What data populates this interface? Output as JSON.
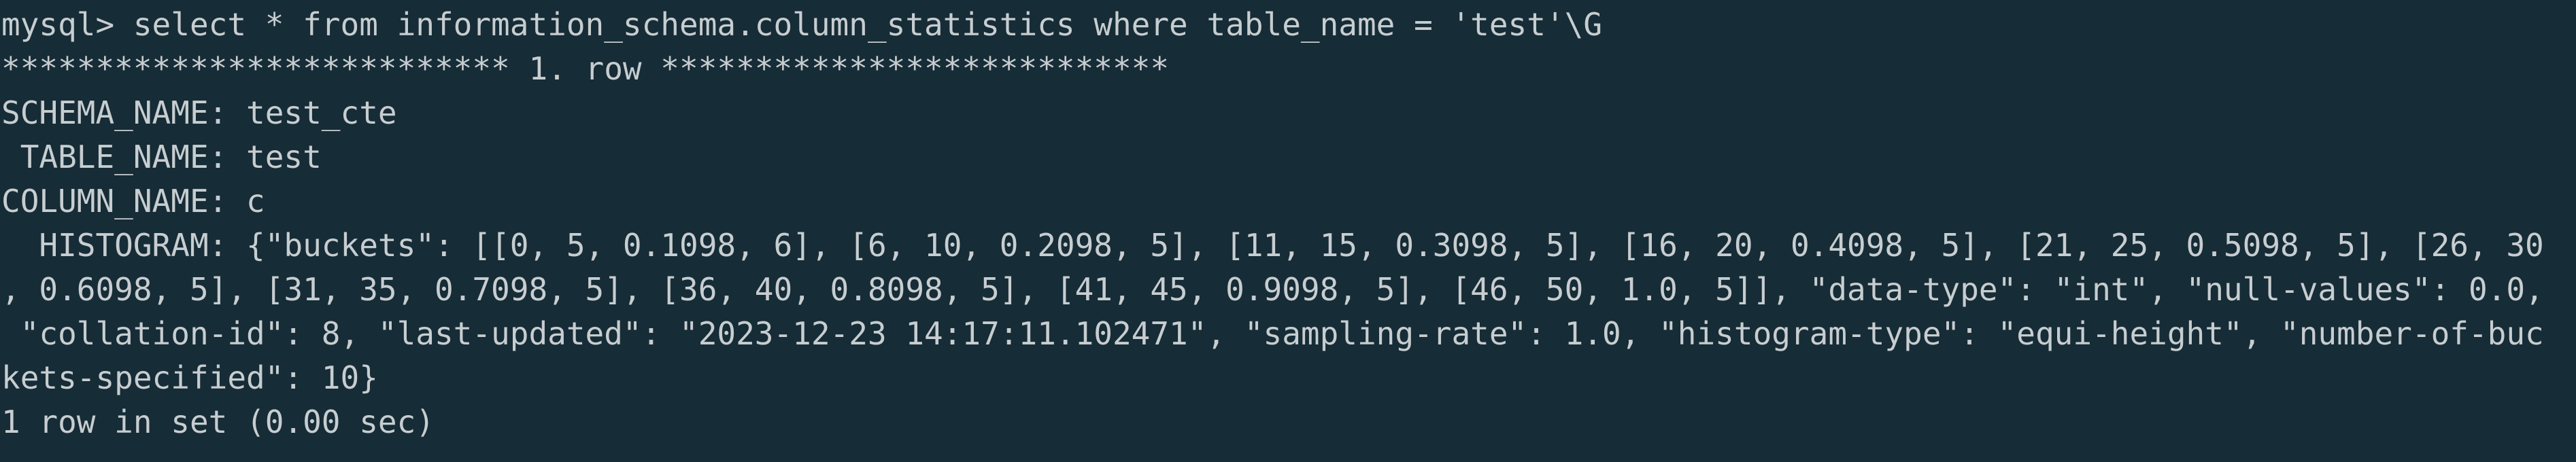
{
  "terminal": {
    "lines": [
      "mysql> select * from information_schema.column_statistics where table_name = 'test'\\G",
      "*************************** 1. row ***************************",
      "SCHEMA_NAME: test_cte",
      " TABLE_NAME: test",
      "COLUMN_NAME: c",
      "  HISTOGRAM: {\"buckets\": [[0, 5, 0.1098, 6], [6, 10, 0.2098, 5], [11, 15, 0.3098, 5], [16, 20, 0.4098, 5], [21, 25, 0.5098, 5], [26, 30",
      ", 0.6098, 5], [31, 35, 0.7098, 5], [36, 40, 0.8098, 5], [41, 45, 0.9098, 5], [46, 50, 1.0, 5]], \"data-type\": \"int\", \"null-values\": 0.0,",
      " \"collation-id\": 8, \"last-updated\": \"2023-12-23 14:17:11.102471\", \"sampling-rate\": 1.0, \"histogram-type\": \"equi-height\", \"number-of-buc",
      "kets-specified\": 10}",
      "1 row in set (0.00 sec)"
    ]
  }
}
